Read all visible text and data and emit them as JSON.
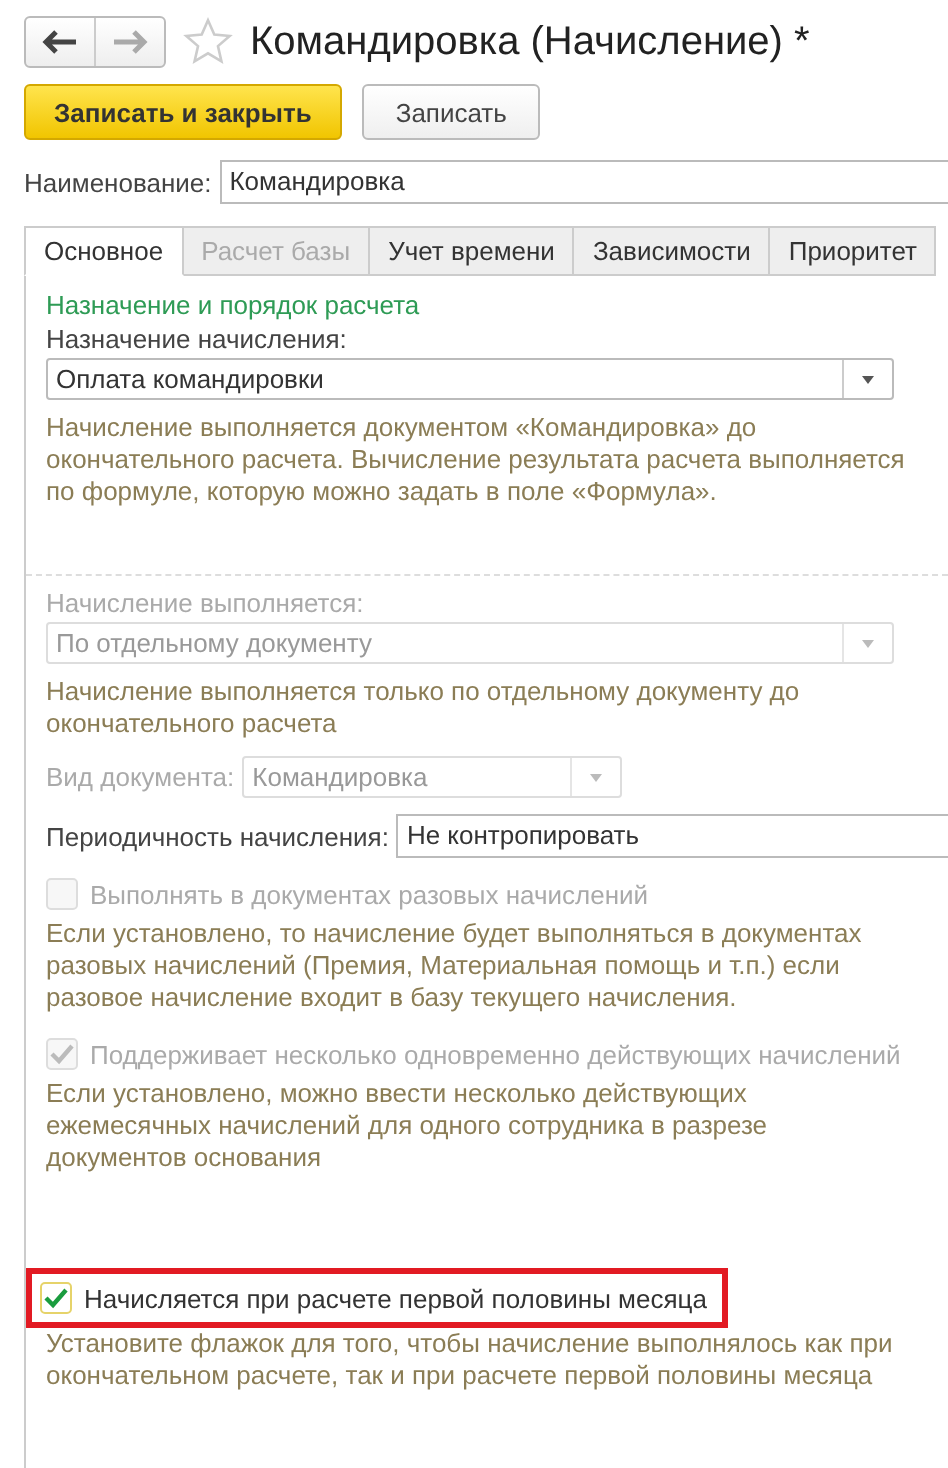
{
  "title": "Командировка (Начисление) *",
  "buttons": [
    {
      "label": "Записать и закрыть",
      "kind": "primary"
    },
    {
      "label": "Записать",
      "kind": "default"
    }
  ],
  "name_field": {
    "label": "Наименование:",
    "value": "Командировка"
  },
  "tabs": [
    {
      "label": "Основное",
      "selected": true,
      "disabled": false
    },
    {
      "label": "Расчет базы",
      "selected": false,
      "disabled": true
    },
    {
      "label": "Учет времени",
      "selected": false,
      "disabled": false
    },
    {
      "label": "Зависимости",
      "selected": false,
      "disabled": false
    },
    {
      "label": "Приоритет",
      "selected": false,
      "disabled": false
    }
  ],
  "section_title": "Назначение и порядок расчета",
  "purpose": {
    "label": "Назначение начисления:",
    "value": "Оплата командировки",
    "disabled": false
  },
  "purpose_hint": "Начисление выполняется документом «Командировка» до окончательного расчета. Вычисление результата расчета выполняется по формуле, которую можно задать в поле «Формула».",
  "execution": {
    "label": "Начисление выполняется:",
    "value": "По отдельному документу",
    "disabled": true
  },
  "execution_hint": "Начисление выполняется только по отдельному документу до окончательного расчета",
  "document_type": {
    "label": "Вид документа:",
    "value": "Командировка",
    "disabled": true
  },
  "periodicity": {
    "label": "Периодичность начисления:",
    "value": "Не контропировать"
  },
  "checkboxes": [
    {
      "label": "Выполнять в документах разовых начислений",
      "checked": false,
      "disabled": true,
      "highlighted": false,
      "hint": "Если установлено, то начисление будет выполняться в документах разовых начислений (Премия, Материальная помощь и т.п.) если разовое начисление входит в базу текущего начисления."
    },
    {
      "label": "Поддерживает несколько одновременно действующих начислений",
      "checked": true,
      "disabled": true,
      "highlighted": false,
      "hint": "Если установлено, можно ввести несколько действующих ежемесячных начислений для одного сотрудника в разрезе документов основания"
    },
    {
      "label": "Начисляется при расчете первой половины месяца",
      "checked": true,
      "disabled": false,
      "highlighted": true,
      "hint": "Установите флажок для того, чтобы начисление выполнялось как при окончательном расчете, так и при расчете первой половины месяца"
    }
  ]
}
